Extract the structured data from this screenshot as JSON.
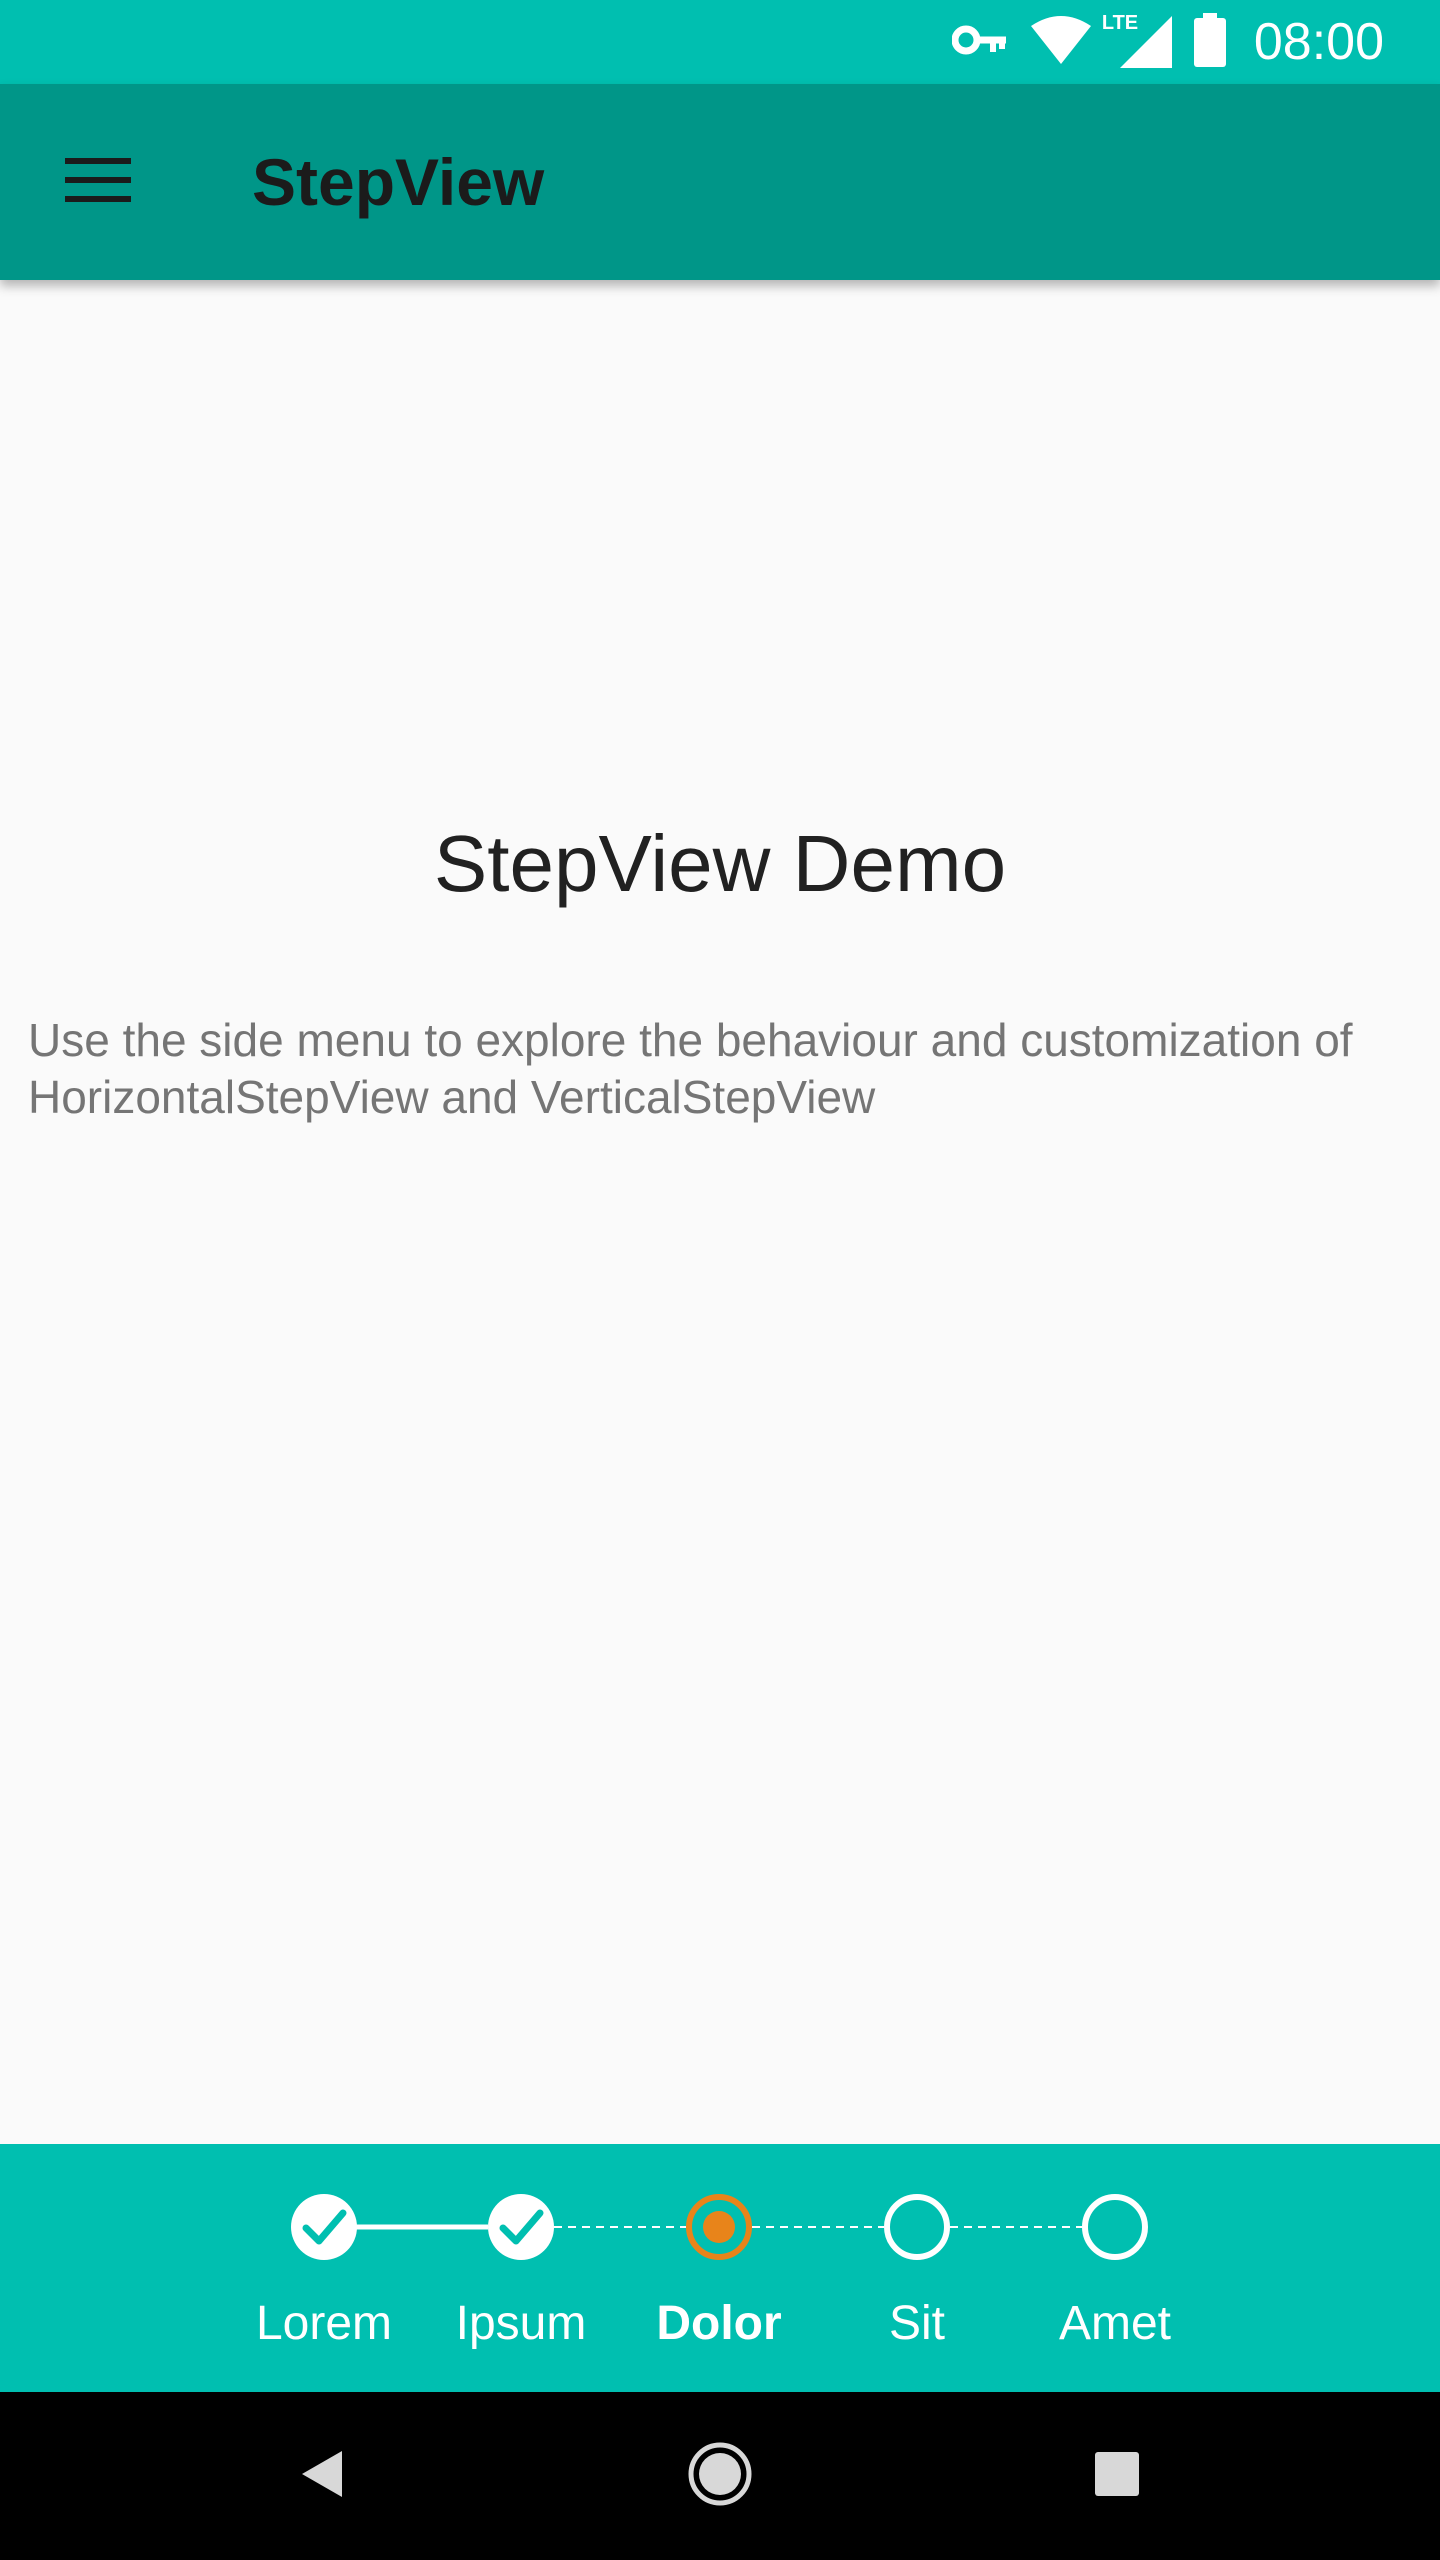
{
  "status_bar": {
    "time": "08:00",
    "icons": [
      "vpn-key-icon",
      "wifi-icon",
      "lte-signal-icon",
      "battery-icon"
    ],
    "network_type": "LTE"
  },
  "app_bar": {
    "title": "StepView",
    "menu_icon": "hamburger-menu-icon"
  },
  "main": {
    "title": "StepView Demo",
    "description": "Use the side menu to explore the behaviour and customization of HorizontalStepView and VerticalStepView"
  },
  "step_view": {
    "steps": [
      {
        "label": "Lorem",
        "state": "completed"
      },
      {
        "label": "Ipsum",
        "state": "completed"
      },
      {
        "label": "Dolor",
        "state": "current"
      },
      {
        "label": "Sit",
        "state": "pending"
      },
      {
        "label": "Amet",
        "state": "pending"
      }
    ],
    "colors": {
      "background": "#00bfb0",
      "completed": "#ffffff",
      "current": "#e8841a",
      "pending": "#ffffff"
    }
  },
  "nav_bar": {
    "buttons": [
      "back-icon",
      "home-icon",
      "recents-icon"
    ]
  },
  "colors": {
    "status_bar": "#00bfb0",
    "app_bar": "#009688",
    "background": "#fafafa"
  }
}
